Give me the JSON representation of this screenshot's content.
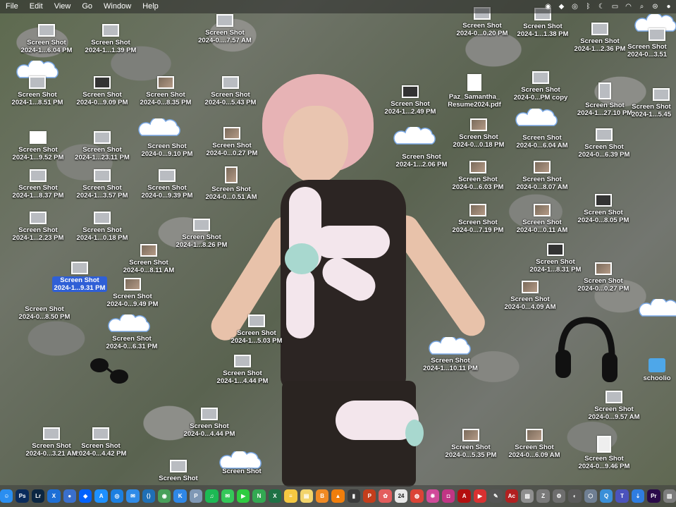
{
  "menubar": {
    "items": [
      "File",
      "Edit",
      "View",
      "Go",
      "Window",
      "Help"
    ],
    "status_icons": [
      "adobe-cc-icon",
      "dropbox-icon",
      "vpn-icon",
      "bluetooth-icon",
      "focus-moon-icon",
      "battery-icon",
      "wifi-icon",
      "spotlight-icon",
      "control-center-icon",
      "siri-icon"
    ]
  },
  "desktop": {
    "icons": [
      {
        "l1": "Screen Shot",
        "l2": "2024-1...6.04 PM"
      },
      {
        "l1": "Screen Shot",
        "l2": "2024-1...1.39 PM"
      },
      {
        "l1": "Screen Shot",
        "l2": "2024-0....7.57 AM"
      },
      {
        "l1": "Screen Shot",
        "l2": "2024-0...0.20 PM"
      },
      {
        "l1": "Screen Shot",
        "l2": "2024-1...1.38 PM"
      },
      {
        "l1": "Screen Shot",
        "l2": "2024-1...2.36 PM"
      },
      {
        "l1": "Screen Shot",
        "l2": "2024-0...3.51"
      },
      {
        "l1": "Screen Shot",
        "l2": "2024-1...8.51 PM"
      },
      {
        "l1": "Screen Shot",
        "l2": "2024-0...9.09 PM"
      },
      {
        "l1": "Screen Shot",
        "l2": "2024-0...8.35 PM"
      },
      {
        "l1": "Screen Shot",
        "l2": "2024-0...5.43 PM"
      },
      {
        "l1": "Screen Shot",
        "l2": "2024-1...2.49 PM"
      },
      {
        "l1": "Paz_Samantha_",
        "l2": "Resume2024.pdf"
      },
      {
        "l1": "Screen Shot",
        "l2": "2024-0...PM copy"
      },
      {
        "l1": "Screen Shot",
        "l2": "2024-1...27.10 PM"
      },
      {
        "l1": "Screen Shot",
        "l2": "2024-1...5.45"
      },
      {
        "l1": "Screen Shot",
        "l2": "2024-1...9.52 PM"
      },
      {
        "l1": "Screen Shot",
        "l2": "2024-1...23.11 PM"
      },
      {
        "l1": "Screen Shot",
        "l2": "2024-0...9.10 PM"
      },
      {
        "l1": "Screen Shot",
        "l2": "2024-0...0.27 PM"
      },
      {
        "l1": "Screen Shot",
        "l2": "2024-1...2.06 PM"
      },
      {
        "l1": "Screen Shot",
        "l2": "2024-0...0.18 PM"
      },
      {
        "l1": "Screen Shot",
        "l2": "2024-0...6.04 AM"
      },
      {
        "l1": "Screen Shot",
        "l2": "2024-0...6.39 PM"
      },
      {
        "l1": "Screen Shot",
        "l2": "2024-1...8.37 PM"
      },
      {
        "l1": "Screen Shot",
        "l2": "2024-1...3.57 PM"
      },
      {
        "l1": "Screen Shot",
        "l2": "2024-0...9.39 PM"
      },
      {
        "l1": "Screen Shot",
        "l2": "2024-0...0.51 AM"
      },
      {
        "l1": "Screen Shot",
        "l2": "2024-0...6.03 PM"
      },
      {
        "l1": "Screen Shot",
        "l2": "2024-0...8.07 AM"
      },
      {
        "l1": "Screen Shot",
        "l2": "2024-1...2.23 PM"
      },
      {
        "l1": "Screen Shot",
        "l2": "2024-1...0.18 PM"
      },
      {
        "l1": "Screen Shot",
        "l2": "2024-1...8.26 PM"
      },
      {
        "l1": "Screen Shot",
        "l2": "2024-0...7.19 PM"
      },
      {
        "l1": "Screen Shot",
        "l2": "2024-0...0.11 AM"
      },
      {
        "l1": "Screen Shot",
        "l2": "2024-0...8.05 PM"
      },
      {
        "l1": "Screen Shot",
        "l2": "2024-1...9.31 PM"
      },
      {
        "l1": "Screen Shot",
        "l2": "2024-0...8.11 AM"
      },
      {
        "l1": "Screen Shot",
        "l2": "2024-1...8.31 PM"
      },
      {
        "l1": "Screen Shot",
        "l2": "2024-0...0.27 PM"
      },
      {
        "l1": "Screen Shot",
        "l2": "2024-0...8.50 PM"
      },
      {
        "l1": "Screen Shot",
        "l2": "2024-0...9.49 PM"
      },
      {
        "l1": "Screen Shot",
        "l2": "2024-0...4.09 AM"
      },
      {
        "l1": "Screen Shot",
        "l2": "2024-0...6.31 PM"
      },
      {
        "l1": "Screen Shot",
        "l2": "2024-1...5.03 PM"
      },
      {
        "l1": "Screen Shot",
        "l2": "2024-1...10.11 PM"
      },
      {
        "l1": "Screen Shot",
        "l2": "2024-1...4.44 PM"
      },
      {
        "l1": "Screen Shot",
        "l2": "2024-0...4.44 PM"
      },
      {
        "l1": "Screen Shot",
        "l2": "2024-0...9.57 AM"
      },
      {
        "l1": "Screen Shot",
        "l2": "2024-0...9.46 PM"
      },
      {
        "l1": "Screen Shot",
        "l2": "2024-0...4.42 PM"
      },
      {
        "l1": "Screen Shot",
        "l2": "2024-0...3.21 AM"
      },
      {
        "l1": "Screen Shot",
        "l2": "2024-0...5.35 PM"
      },
      {
        "l1": "Screen Shot",
        "l2": "2024-0...6.09 AM"
      },
      {
        "l1": "Screen Shot",
        "l2": ""
      },
      {
        "l1": "Screen Shot",
        "l2": ""
      }
    ],
    "folder": {
      "label": "schoolio"
    }
  },
  "dock": {
    "apps": [
      {
        "name": "finder",
        "glyph": "☺",
        "color": "#2a8ef0"
      },
      {
        "name": "photoshop",
        "glyph": "Ps",
        "color": "#0a2b5c"
      },
      {
        "name": "lightroom",
        "glyph": "Lr",
        "color": "#0b2642"
      },
      {
        "name": "xcode",
        "glyph": "X",
        "color": "#1d6fd6"
      },
      {
        "name": "chrome-canary",
        "glyph": "●",
        "color": "#3a6fcc"
      },
      {
        "name": "dropbox",
        "glyph": "◆",
        "color": "#0061fe"
      },
      {
        "name": "app-store",
        "glyph": "A",
        "color": "#1e90ff"
      },
      {
        "name": "safari",
        "glyph": "◎",
        "color": "#1b7fe0"
      },
      {
        "name": "mail",
        "glyph": "✉",
        "color": "#2f8be8"
      },
      {
        "name": "vscode",
        "glyph": "⟨⟩",
        "color": "#1f6fb5"
      },
      {
        "name": "maps",
        "glyph": "◉",
        "color": "#48a05a"
      },
      {
        "name": "keynote",
        "glyph": "K",
        "color": "#2f87e6"
      },
      {
        "name": "preview",
        "glyph": "P",
        "color": "#7f98b5"
      },
      {
        "name": "spotify",
        "glyph": "♫",
        "color": "#1db954"
      },
      {
        "name": "messages",
        "glyph": "✉",
        "color": "#34c759"
      },
      {
        "name": "facetime",
        "glyph": "▶",
        "color": "#2ecc40"
      },
      {
        "name": "numbers",
        "glyph": "N",
        "color": "#33a852"
      },
      {
        "name": "excel",
        "glyph": "X",
        "color": "#1e7145"
      },
      {
        "name": "notes",
        "glyph": "≡",
        "color": "#f5c841"
      },
      {
        "name": "stickies",
        "glyph": "▤",
        "color": "#f2d46b"
      },
      {
        "name": "books",
        "glyph": "B",
        "color": "#f08a24"
      },
      {
        "name": "vlc",
        "glyph": "▲",
        "color": "#f07e0c"
      },
      {
        "name": "activity-monitor",
        "glyph": "▮",
        "color": "#3b3b3b"
      },
      {
        "name": "powerpoint",
        "glyph": "P",
        "color": "#c43e1c"
      },
      {
        "name": "photos",
        "glyph": "✿",
        "color": "#e35d5d"
      },
      {
        "name": "calendar",
        "glyph": "24",
        "color": "#e8e8e8"
      },
      {
        "name": "chrome",
        "glyph": "◍",
        "color": "#db4437"
      },
      {
        "name": "pinwheel",
        "glyph": "✹",
        "color": "#d04a9a"
      },
      {
        "name": "instagram",
        "glyph": "◘",
        "color": "#c13584"
      },
      {
        "name": "acrobat",
        "glyph": "A",
        "color": "#b40f0f"
      },
      {
        "name": "pdf-reader",
        "glyph": "▶",
        "color": "#d83131"
      },
      {
        "name": "script-editor",
        "glyph": "✎",
        "color": "#555555"
      },
      {
        "name": "acrobat-distiller",
        "glyph": "Ac",
        "color": "#b12020"
      },
      {
        "name": "trash-preview",
        "glyph": "▧",
        "color": "#8f8f8f"
      },
      {
        "name": "zotero",
        "glyph": "Z",
        "color": "#7a7a7a"
      },
      {
        "name": "system-preferences",
        "glyph": "⚙",
        "color": "#6e6e6e"
      },
      {
        "name": "digital-color-meter",
        "glyph": "◐",
        "color": "#5a5a5a"
      },
      {
        "name": "disk-utility",
        "glyph": "⬡",
        "color": "#6f7f93"
      },
      {
        "name": "quicktime",
        "glyph": "Q",
        "color": "#3a8fd8"
      },
      {
        "name": "teams",
        "glyph": "T",
        "color": "#4b53bc"
      },
      {
        "name": "downloads-stack",
        "glyph": "⇣",
        "color": "#2f7de0"
      },
      {
        "name": "premiere-pro",
        "glyph": "Pr",
        "color": "#2a0a4a"
      },
      {
        "name": "trash",
        "glyph": "▥",
        "color": "#7d7d7d"
      }
    ]
  }
}
